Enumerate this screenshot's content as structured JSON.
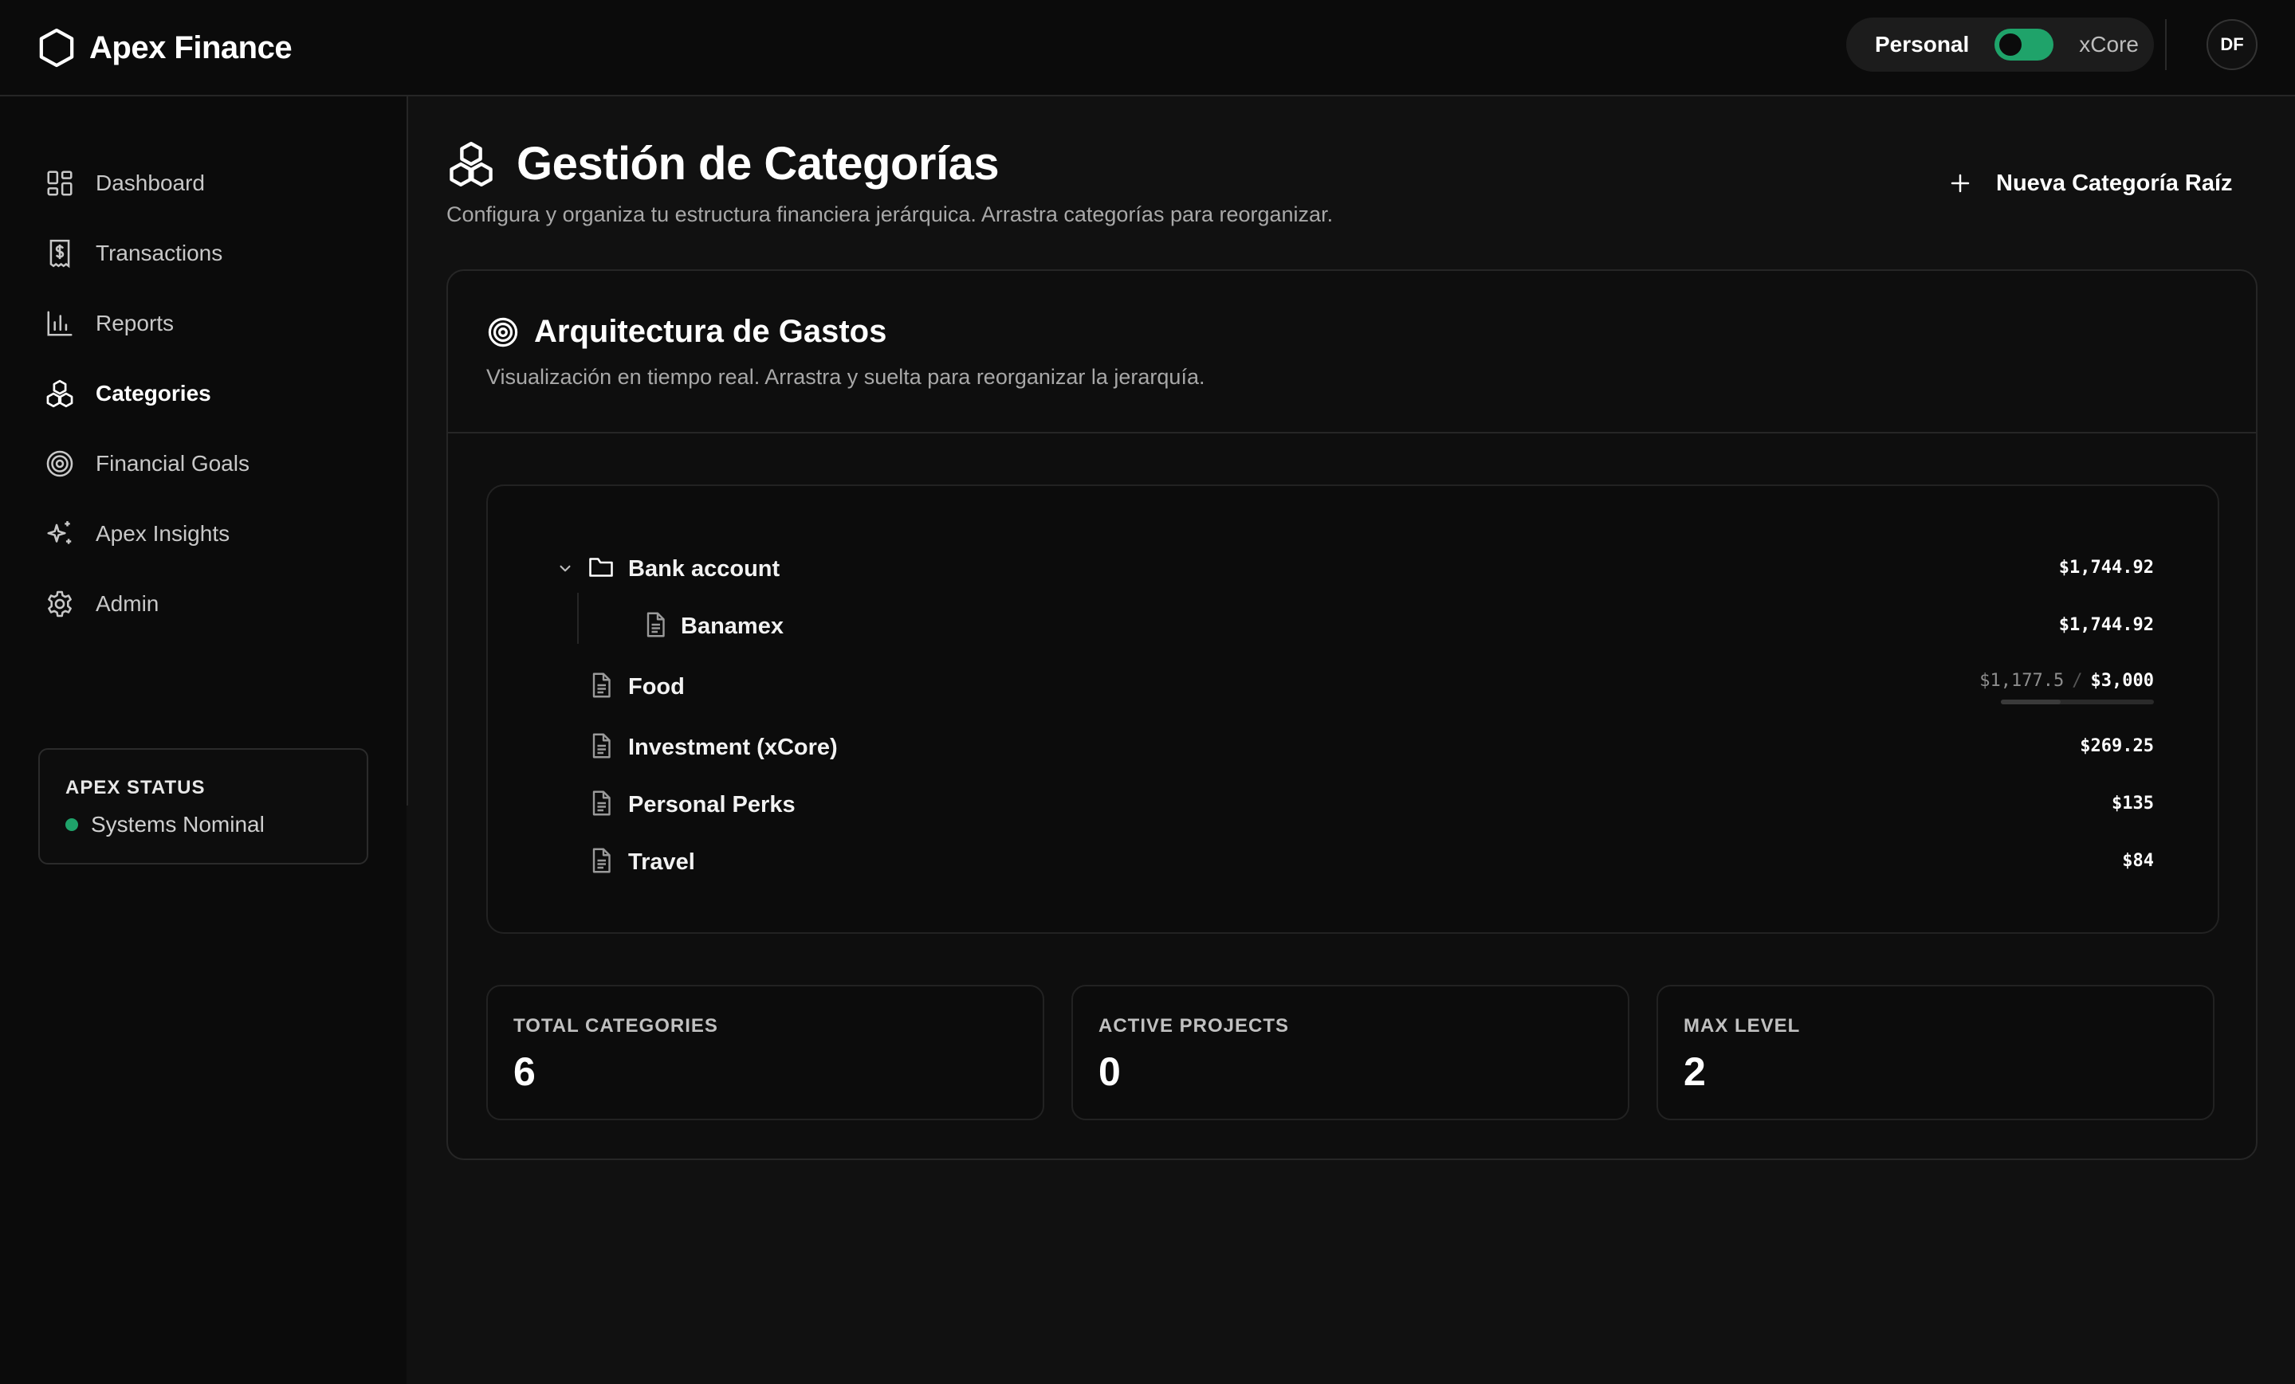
{
  "app": {
    "name": "Apex Finance",
    "logo_icon": "hexagon-icon"
  },
  "context_switch": {
    "left_label": "Personal",
    "right_label": "xCore",
    "toggle_on": true,
    "accent": "#1fa36a"
  },
  "user": {
    "initials": "DF"
  },
  "sidebar": {
    "items": [
      {
        "label": "Dashboard",
        "icon": "dashboard-icon",
        "active": false
      },
      {
        "label": "Transactions",
        "icon": "dollar-receipt-icon",
        "active": false
      },
      {
        "label": "Reports",
        "icon": "bar-chart-icon",
        "active": false
      },
      {
        "label": "Categories",
        "icon": "blocks-icon",
        "active": true
      },
      {
        "label": "Financial Goals",
        "icon": "target-icon",
        "active": false
      },
      {
        "label": "Apex Insights",
        "icon": "sparkles-icon",
        "active": false
      },
      {
        "label": "Admin",
        "icon": "gear-icon",
        "active": false
      }
    ],
    "status": {
      "title": "APEX STATUS",
      "text": "Systems Nominal",
      "color": "#1fa36a"
    }
  },
  "page": {
    "title": "Gestión de Categorías",
    "subtitle": "Configura y organiza tu estructura financiera jerárquica. Arrastra categorías para reorganizar.",
    "new_root_button": "Nueva Categoría Raíz"
  },
  "card": {
    "title": "Arquitectura de Gastos",
    "subtitle": "Visualización en tiempo real. Arrastra y suelta para reorganizar la jerarquía.",
    "tree": [
      {
        "label": "Bank account",
        "amount": "$1,744.92",
        "type": "folder",
        "expanded": true,
        "level": 1
      },
      {
        "label": "Banamex",
        "amount": "$1,744.92",
        "type": "file",
        "level": 2
      },
      {
        "label": "Food",
        "spent": "$1,177.5",
        "separator": "/",
        "limit": "$3,000",
        "progress": 0.3925,
        "type": "file",
        "level": 1
      },
      {
        "label": "Investment (xCore)",
        "amount": "$269.25",
        "type": "file",
        "level": 1
      },
      {
        "label": "Personal Perks",
        "amount": "$135",
        "type": "file",
        "level": 1
      },
      {
        "label": "Travel",
        "amount": "$84",
        "type": "file",
        "level": 1
      }
    ],
    "stats": [
      {
        "label": "TOTAL CATEGORIES",
        "value": "6"
      },
      {
        "label": "ACTIVE PROJECTS",
        "value": "0"
      },
      {
        "label": "MAX LEVEL",
        "value": "2"
      }
    ]
  }
}
